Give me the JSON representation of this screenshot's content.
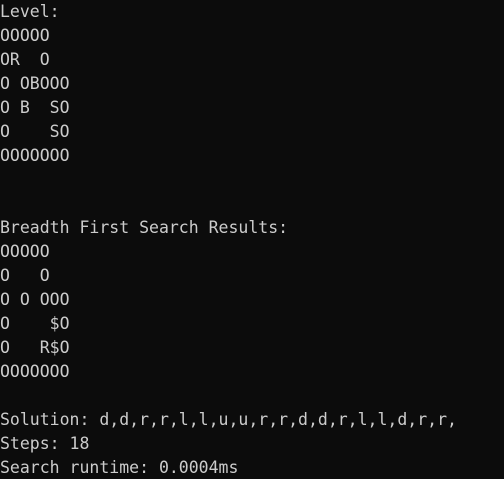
{
  "level": {
    "header": "Level:",
    "rows": [
      "OOOOO",
      "OR  O",
      "O OBOOO",
      "O B  SO",
      "O    SO",
      "OOOOOOO"
    ]
  },
  "bfs": {
    "header": "Breadth First Search Results:",
    "rows": [
      "OOOOO",
      "O   O",
      "O O OOO",
      "O    $O",
      "O   R$O",
      "OOOOOOO"
    ]
  },
  "summary": {
    "solution": "Solution: d,d,r,r,l,l,u,u,r,r,d,d,r,l,l,d,r,r,",
    "steps": "Steps: 18",
    "runtime": "Search runtime: 0.0004ms"
  }
}
